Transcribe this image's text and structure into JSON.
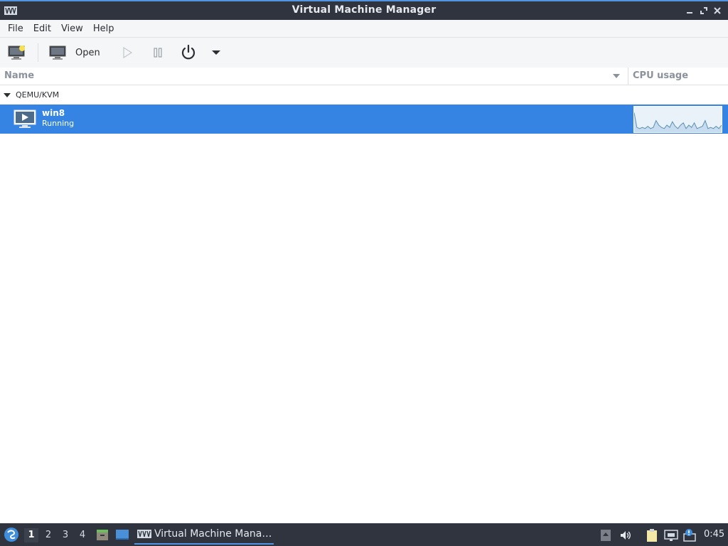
{
  "window": {
    "title": "Virtual Machine Manager",
    "controls": [
      "minimize",
      "maximize",
      "close"
    ]
  },
  "menubar": {
    "items": [
      "File",
      "Edit",
      "View",
      "Help"
    ]
  },
  "toolbar": {
    "new_vm_icon": "new-vm-icon",
    "open_label": "Open",
    "run_icon": "play-icon",
    "pause_icon": "pause-icon",
    "shutdown_icon": "power-icon",
    "shutdown_menu_icon": "dropdown-arrow-icon"
  },
  "table": {
    "columns": [
      "Name",
      "CPU usage"
    ],
    "groups": [
      {
        "label": "QEMU/KVM",
        "vms": [
          {
            "name": "win8",
            "status": "Running",
            "cpu_samples": [
              0.8,
              0.15,
              0.1,
              0.15,
              0.1,
              0.2,
              0.1,
              0.15,
              0.45,
              0.25,
              0.15,
              0.1,
              0.25,
              0.15,
              0.4,
              0.2,
              0.1,
              0.25,
              0.35,
              0.1,
              0.25,
              0.15,
              0.35,
              0.1,
              0.15,
              0.2,
              0.45,
              0.1,
              0.15,
              0.1,
              0.2,
              0.1,
              0.25
            ]
          }
        ]
      }
    ]
  },
  "taskbar": {
    "workspaces": [
      "1",
      "2",
      "3",
      "4"
    ],
    "active_workspace": "1",
    "task_label": "Virtual Machine Mana…",
    "clock": "0:45"
  },
  "colors": {
    "titlebar_bg": "#2f343f",
    "accent": "#5294e2",
    "selection": "#3584e4",
    "graph_line": "#5a8fb5"
  }
}
